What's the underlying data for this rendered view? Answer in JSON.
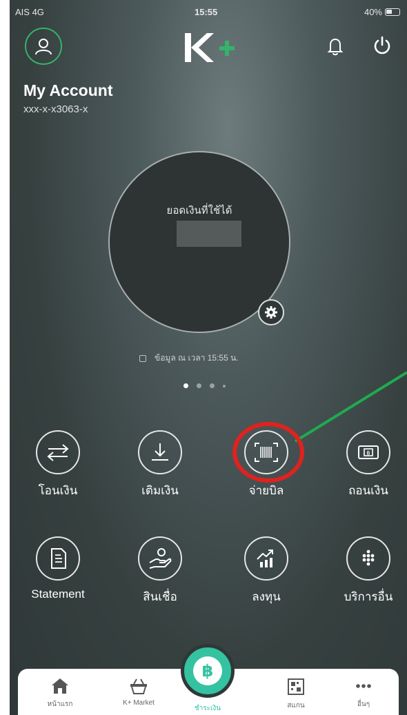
{
  "status_bar": {
    "carrier": "AIS 4G",
    "time": "15:55",
    "battery": "40%"
  },
  "header": {
    "account_title": "My Account",
    "account_number": "xxx-x-x3063-x"
  },
  "balance": {
    "label": "ยอดเงินที่ใช้ได้"
  },
  "info": {
    "text": "ข้อมูล ณ เวลา 15:55 น."
  },
  "menu": [
    {
      "label": "โอนเงิน",
      "icon": "transfer-icon"
    },
    {
      "label": "เติมเงิน",
      "icon": "top-up-icon"
    },
    {
      "label": "จ่ายบิล",
      "icon": "barcode-scan-icon"
    },
    {
      "label": "ถอนเงิน",
      "icon": "cash-withdraw-icon"
    },
    {
      "label": "Statement",
      "icon": "document-icon"
    },
    {
      "label": "สินเชื่อ",
      "icon": "loan-hand-icon"
    },
    {
      "label": "ลงทุน",
      "icon": "invest-chart-icon"
    },
    {
      "label": "บริการอื่น",
      "icon": "more-services-icon"
    }
  ],
  "nav": [
    {
      "label": "หน้าแรก",
      "icon": "home-icon"
    },
    {
      "label": "K+ Market",
      "icon": "basket-icon"
    },
    {
      "label": "สแกน",
      "icon": "qr-scan-icon"
    },
    {
      "label": "อื่นๆ",
      "icon": "more-dots-icon"
    }
  ],
  "center_nav": {
    "label": "ชำระเงิน",
    "symbol": "฿"
  },
  "colors": {
    "accent_green": "#34b36b",
    "highlight_red": "#e0221e",
    "scan_teal": "#35c2a0"
  }
}
